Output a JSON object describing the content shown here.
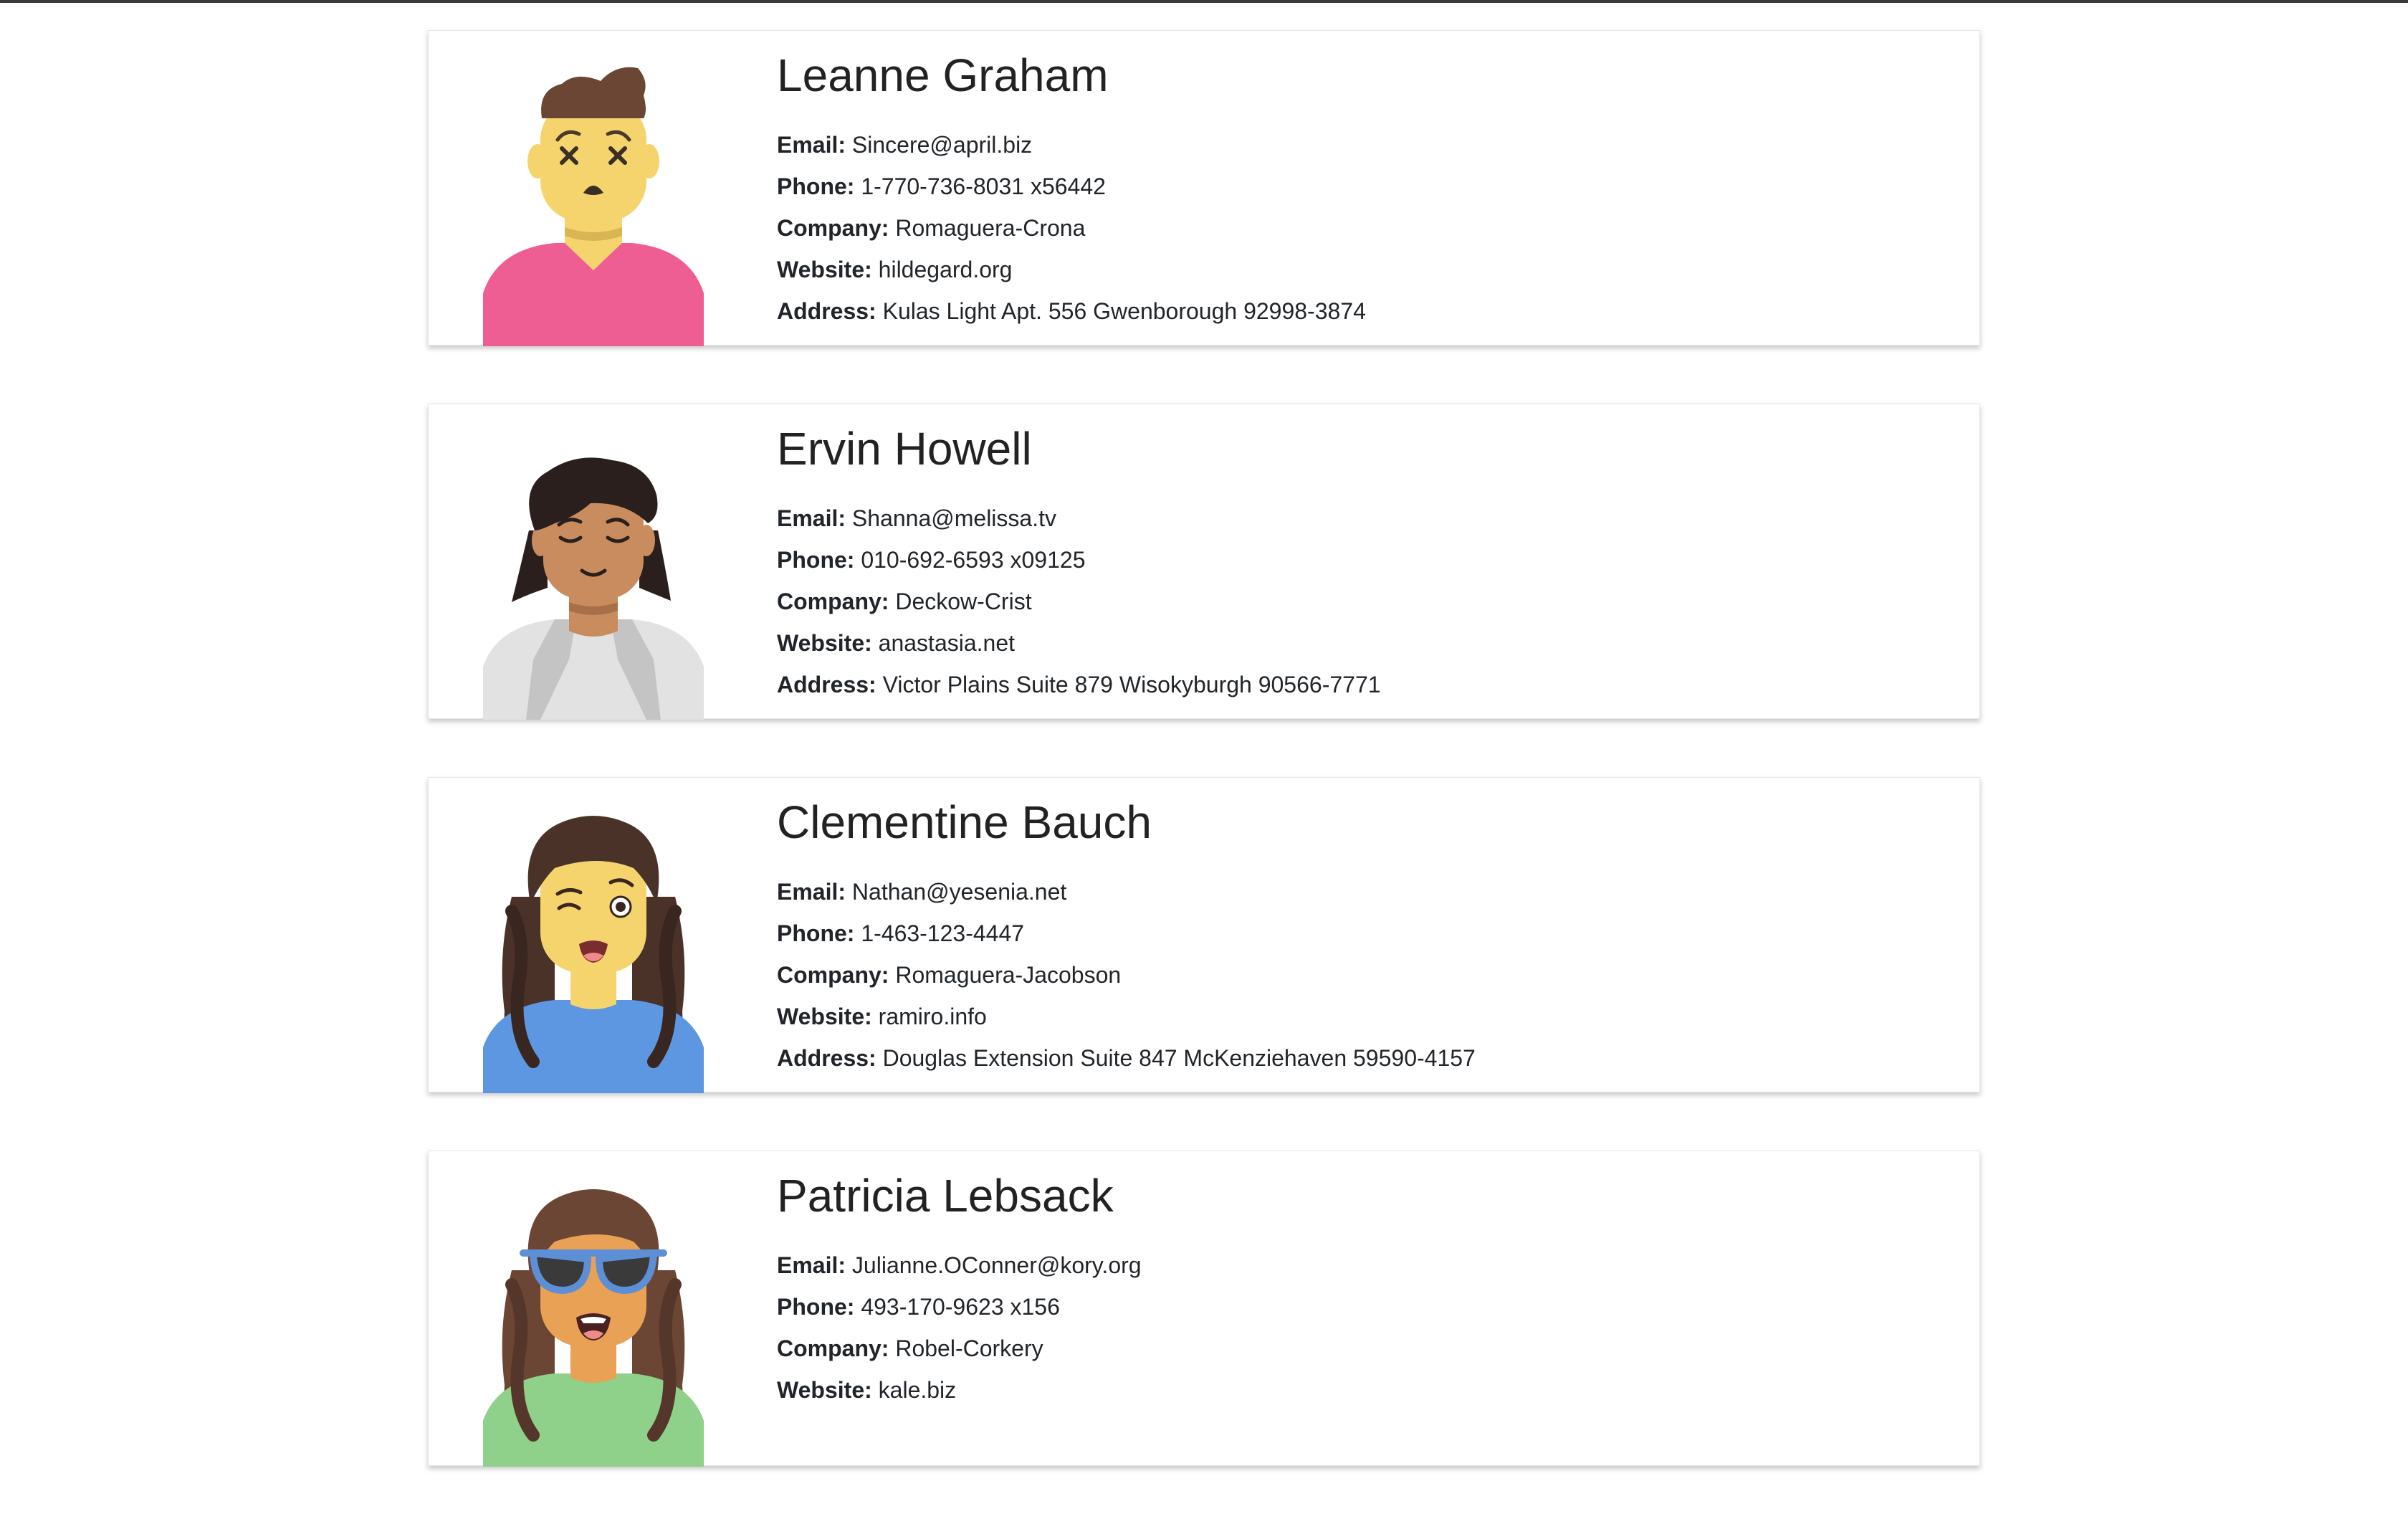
{
  "field_labels": {
    "email": "Email:",
    "phone": "Phone:",
    "company": "Company:",
    "website": "Website:",
    "address": "Address:"
  },
  "users": [
    {
      "name": "Leanne Graham",
      "email": "Sincere@april.biz",
      "phone": "1-770-736-8031 x56442",
      "company": "Romaguera-Crona",
      "website": "hildegard.org",
      "address": "Kulas Light Apt. 556 Gwenborough 92998-3874",
      "avatar_icon": "avatar-dizzy-man-icon"
    },
    {
      "name": "Ervin Howell",
      "email": "Shanna@melissa.tv",
      "phone": "010-692-6593 x09125",
      "company": "Deckow-Crist",
      "website": "anastasia.net",
      "address": "Victor Plains Suite 879 Wisokyburgh 90566-7771",
      "avatar_icon": "avatar-calm-person-icon"
    },
    {
      "name": "Clementine Bauch",
      "email": "Nathan@yesenia.net",
      "phone": "1-463-123-4447",
      "company": "Romaguera-Jacobson",
      "website": "ramiro.info",
      "address": "Douglas Extension Suite 847 McKenziehaven 59590-4157",
      "avatar_icon": "avatar-winking-woman-icon"
    },
    {
      "name": "Patricia Lebsack",
      "email": "Julianne.OConner@kory.org",
      "phone": "493-170-9623 x156",
      "company": "Robel-Corkery",
      "website": "kale.biz",
      "address": "",
      "avatar_icon": "avatar-sunglasses-woman-icon"
    }
  ],
  "colors": {
    "skin_yellow": "#f5d46e",
    "skin_tan": "#c98c5e",
    "skin_orange": "#e9a156",
    "hair_brown": "#6b4634",
    "hair_dark": "#2a1f1c",
    "shirt_pink": "#ef5e93",
    "shirt_grey": "#e2e2e2",
    "shirt_blue": "#5d97e2",
    "glasses_blue": "#5c8fd6"
  }
}
